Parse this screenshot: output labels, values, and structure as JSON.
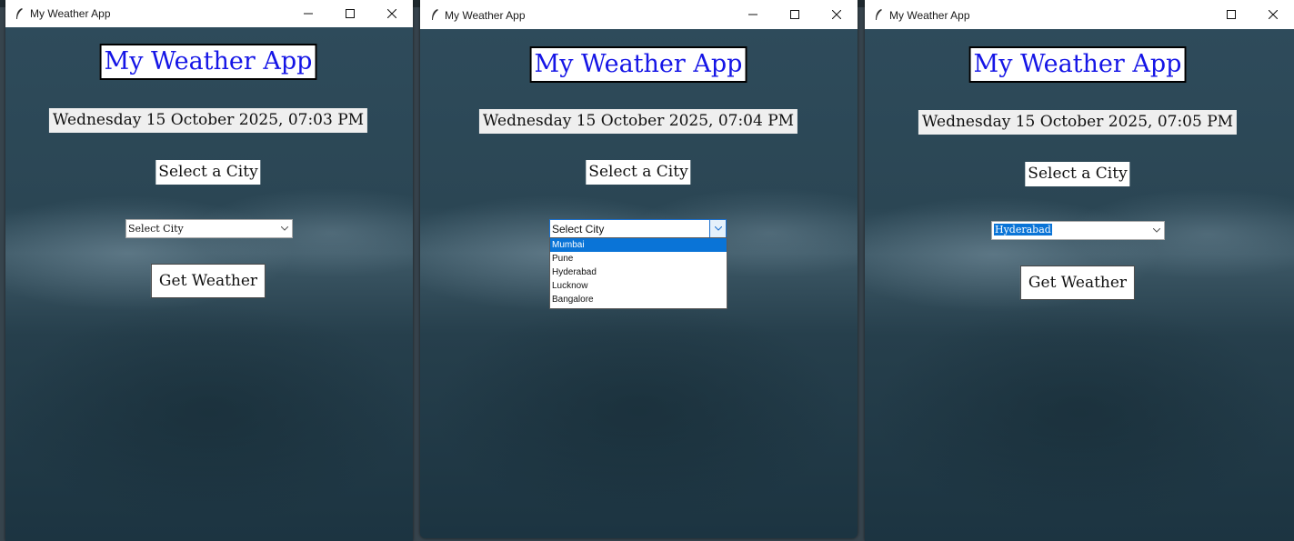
{
  "windows": [
    {
      "title": "My Weather App",
      "heading": "My Weather App",
      "datetime": "Wednesday 15 October 2025, 07:03 PM",
      "select_label": "Select a City",
      "combo_value": "Select City",
      "button_label": "Get Weather"
    },
    {
      "title": "My Weather App",
      "heading": "My Weather App",
      "datetime": "Wednesday 15 October 2025, 07:04 PM",
      "select_label": "Select a City",
      "combo_value": "Select City",
      "dropdown_options": [
        "Mumbai",
        "Pune",
        "Hyderabad",
        "Lucknow",
        "Bangalore"
      ],
      "highlighted_option": "Mumbai"
    },
    {
      "title": "My Weather App",
      "heading": "My Weather App",
      "datetime": "Wednesday 15 October 2025, 07:05 PM",
      "select_label": "Select a City",
      "combo_value": "Hyderabad",
      "button_label": "Get Weather"
    }
  ],
  "icons": {
    "app": "feather-icon",
    "minimize": "minimize-icon",
    "maximize": "maximize-icon",
    "close": "close-icon",
    "dropdown": "chevron-down-icon"
  },
  "colors": {
    "heading_text": "#1515e6",
    "selection": "#0a74d7",
    "window_background": "#1f3644"
  }
}
